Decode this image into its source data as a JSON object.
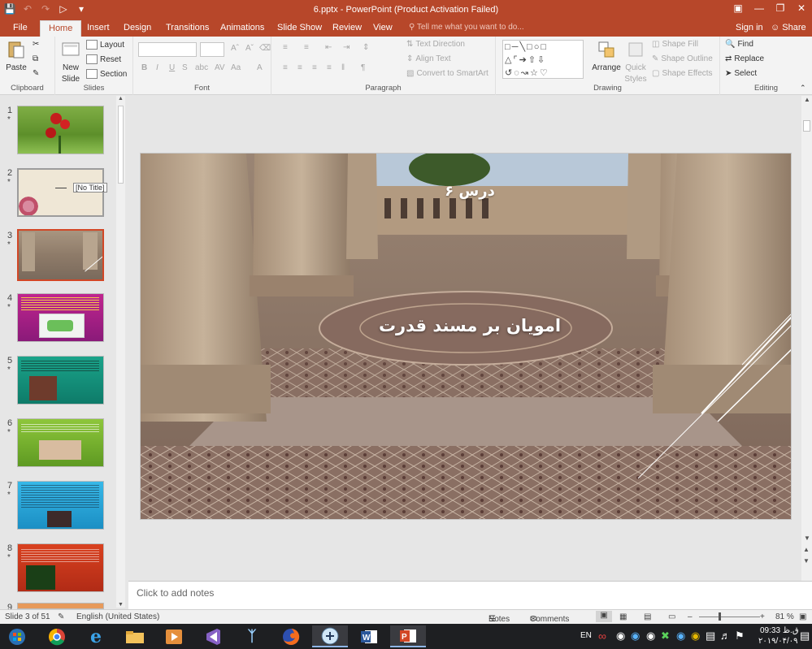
{
  "window": {
    "title": "6.pptx - PowerPoint (Product Activation Failed)"
  },
  "tabs": [
    "File",
    "Home",
    "Insert",
    "Design",
    "Transitions",
    "Animations",
    "Slide Show",
    "Review",
    "View"
  ],
  "active_tab": "Home",
  "tell_me": "Tell me what you want to do...",
  "account": {
    "signin": "Sign in",
    "share": "Share"
  },
  "ribbon": {
    "clipboard": {
      "paste": "Paste",
      "label": "Clipboard"
    },
    "slides": {
      "new_slide_1": "New",
      "new_slide_2": "Slide",
      "layout": "Layout",
      "reset": "Reset",
      "section": "Section",
      "label": "Slides"
    },
    "font": {
      "label": "Font"
    },
    "paragraph": {
      "text_direction": "Text Direction",
      "align_text": "Align Text",
      "convert_smartart": "Convert to SmartArt",
      "label": "Paragraph"
    },
    "drawing": {
      "arrange": "Arrange",
      "quick_styles_1": "Quick",
      "quick_styles_2": "Styles",
      "shape_fill": "Shape Fill",
      "shape_outline": "Shape Outline",
      "shape_effects": "Shape Effects",
      "label": "Drawing"
    },
    "editing": {
      "find": "Find",
      "replace": "Replace",
      "select": "Select",
      "label": "Editing"
    }
  },
  "slides": [
    {
      "num": "1",
      "star": "*"
    },
    {
      "num": "2",
      "star": "*",
      "tooltip": "[No Title]"
    },
    {
      "num": "3",
      "star": "*"
    },
    {
      "num": "4",
      "star": "*"
    },
    {
      "num": "5",
      "star": "*"
    },
    {
      "num": "6",
      "star": "*"
    },
    {
      "num": "7",
      "star": "*"
    },
    {
      "num": "8",
      "star": "*"
    },
    {
      "num": "9",
      "star": ""
    }
  ],
  "current_slide": {
    "subtitle": "درس ۶",
    "title": "امویان بر مسند قدرت"
  },
  "notes_placeholder": "Click to add notes",
  "status": {
    "slide_info": "Slide 3 of 51",
    "language": "English (United States)",
    "notes": "Notes",
    "comments": "Comments",
    "zoom": "81 %"
  },
  "taskbar": {
    "lang": "EN",
    "time": "09:33 ق.ظ",
    "date": "۲۰۱۹/۰۴/۰۹"
  },
  "colors": {
    "accent": "#b7472a",
    "selected_border": "#d24726"
  }
}
